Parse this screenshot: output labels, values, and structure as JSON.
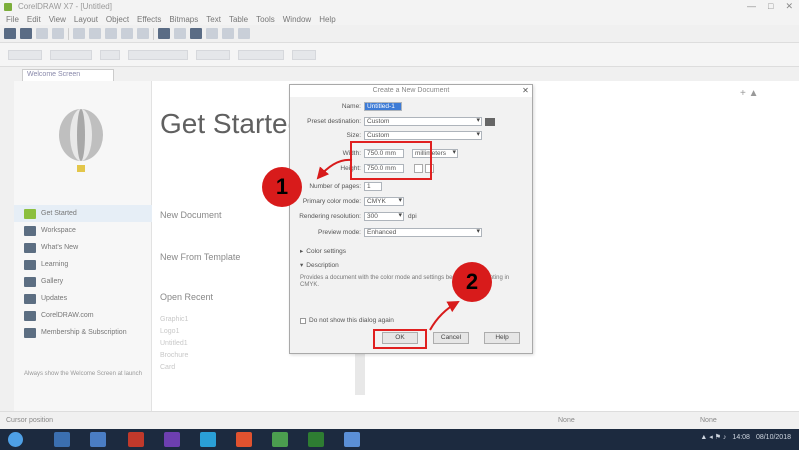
{
  "window": {
    "title": "CorelDRAW X7 - [Untitled]",
    "controls": [
      "—",
      "□",
      "✕"
    ]
  },
  "menubar": {
    "items": [
      "File",
      "Edit",
      "View",
      "Layout",
      "Object",
      "Effects",
      "Bitmaps",
      "Text",
      "Table",
      "Tools",
      "Window",
      "Help"
    ]
  },
  "tab": {
    "label": "Welcome Screen"
  },
  "welcome": {
    "title": "Get Started",
    "links": {
      "new_document": "New Document",
      "new_from_template": "New From Template",
      "open_recent": "Open Recent"
    },
    "recent_items": [
      "Graphic1",
      "Logo1",
      "Untitled1",
      "Brochure",
      "Card"
    ],
    "nav": [
      {
        "label": "Get Started",
        "icon": "get-started-icon"
      },
      {
        "label": "Workspace",
        "icon": "workspace-icon"
      },
      {
        "label": "What's New",
        "icon": "whats-new-icon"
      },
      {
        "label": "Learning",
        "icon": "learning-icon"
      },
      {
        "label": "Gallery",
        "icon": "gallery-icon"
      },
      {
        "label": "Updates",
        "icon": "updates-icon"
      },
      {
        "label": "CorelDRAW.com",
        "icon": "web-icon"
      },
      {
        "label": "Membership & Subscription",
        "icon": "membership-icon"
      }
    ],
    "nav_footer": "Always show the Welcome Screen at launch"
  },
  "dialog": {
    "title": "Create a New Document",
    "fields": {
      "name_label": "Name:",
      "name_value": "Untitled-1",
      "preset_label": "Preset destination:",
      "preset_value": "Custom",
      "size_label": "Size:",
      "size_value": "Custom",
      "width_label": "Width:",
      "width_value": "750.0 mm",
      "height_label": "Height:",
      "height_value": "750.0 mm",
      "units_value": "millimeters",
      "pages_label": "Number of pages:",
      "pages_value": "1",
      "color_mode_label": "Primary color mode:",
      "color_mode_value": "CMYK",
      "resolution_label": "Rendering resolution:",
      "resolution_value": "300",
      "resolution_unit": "dpi",
      "preview_label": "Preview mode:",
      "preview_value": "Enhanced"
    },
    "color_settings": "Color settings",
    "description_label": "Description",
    "description_text": "Provides a document with the color mode and settings best suited to printing in CMYK.",
    "dont_show": "Do not show this dialog again",
    "buttons": {
      "ok": "OK",
      "cancel": "Cancel",
      "help": "Help"
    }
  },
  "annotations": {
    "callout1": "1",
    "callout2": "2",
    "accent": "#d81b1b"
  },
  "statusbar": {
    "left": "Cursor position",
    "middle": "None",
    "right": "None"
  },
  "taskbar": {
    "time": "14:08",
    "date": "08/10/2018"
  }
}
